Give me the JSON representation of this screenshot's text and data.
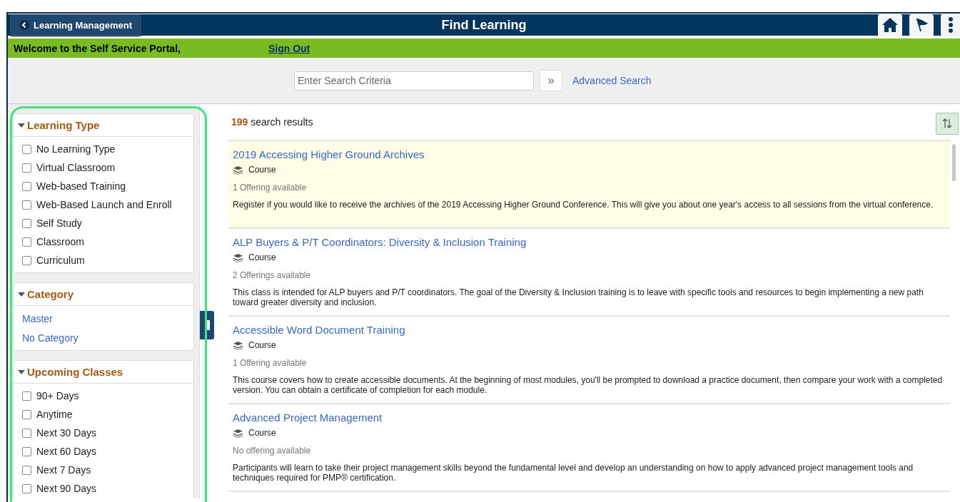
{
  "header": {
    "back_button": "Learning Management",
    "title": "Find Learning"
  },
  "welcome_bar": {
    "text": "Welcome to the Self Service Portal,",
    "sign_out": "Sign Out"
  },
  "search": {
    "placeholder": "Enter Search Criteria",
    "go_button": "»",
    "advanced_link": "Advanced Search"
  },
  "filters": [
    {
      "title": "Learning Type",
      "expanded": true,
      "kind": "checkbox",
      "items": [
        {
          "label": "No Learning Type",
          "checked": false
        },
        {
          "label": "Virtual Classroom",
          "checked": false
        },
        {
          "label": "Web-based Training",
          "checked": false
        },
        {
          "label": "Web-Based Launch and Enroll",
          "checked": false
        },
        {
          "label": "Self Study",
          "checked": false
        },
        {
          "label": "Classroom",
          "checked": false
        },
        {
          "label": "Curriculum",
          "checked": false
        }
      ]
    },
    {
      "title": "Category",
      "expanded": true,
      "kind": "link",
      "items": [
        {
          "label": "Master"
        },
        {
          "label": "No Category"
        }
      ]
    },
    {
      "title": "Upcoming Classes",
      "expanded": true,
      "kind": "checkbox",
      "items": [
        {
          "label": "90+ Days",
          "checked": false
        },
        {
          "label": "Anytime",
          "checked": false
        },
        {
          "label": "Next 30 Days",
          "checked": false
        },
        {
          "label": "Next 60 Days",
          "checked": false
        },
        {
          "label": "Next 7 Days",
          "checked": false
        },
        {
          "label": "Next 90 Days",
          "checked": false
        }
      ]
    }
  ],
  "results": {
    "count": "199",
    "count_label": "search results",
    "items": [
      {
        "title": "2019 Accessing Higher Ground Archives",
        "type": "Course",
        "offerings": "1 Offering available",
        "description": "Register if you would like to receive the archives of the 2019 Accessing Higher Ground Conference. This will give you about one year's access to all sessions from the virtual conference.",
        "selected": true
      },
      {
        "title": "ALP Buyers & P/T Coordinators: Diversity & Inclusion Training",
        "type": "Course",
        "offerings": "2 Offerings available",
        "description": "This class is intended for ALP buyers and P/T coordinators. The goal of the Diversity & Inclusion training is to leave with specific tools and resources to begin implementing a new path toward greater diversity and inclusion.",
        "selected": false
      },
      {
        "title": "Accessible Word Document Training",
        "type": "Course",
        "offerings": "1 Offering available",
        "description": "This course covers how to create accessible documents. At the beginning of most modules, you'll be prompted to download a practice document, then compare your work with a completed version. You can obtain a certificate of completion for each module.",
        "selected": false
      },
      {
        "title": "Advanced Project Management",
        "type": "Course",
        "offerings": "No offering available",
        "description": "Participants will learn to take their project management skills beyond the fundamental level and develop an understanding on how to apply advanced project management tools and techniques required for PMP® certification.",
        "selected": false
      }
    ]
  }
}
